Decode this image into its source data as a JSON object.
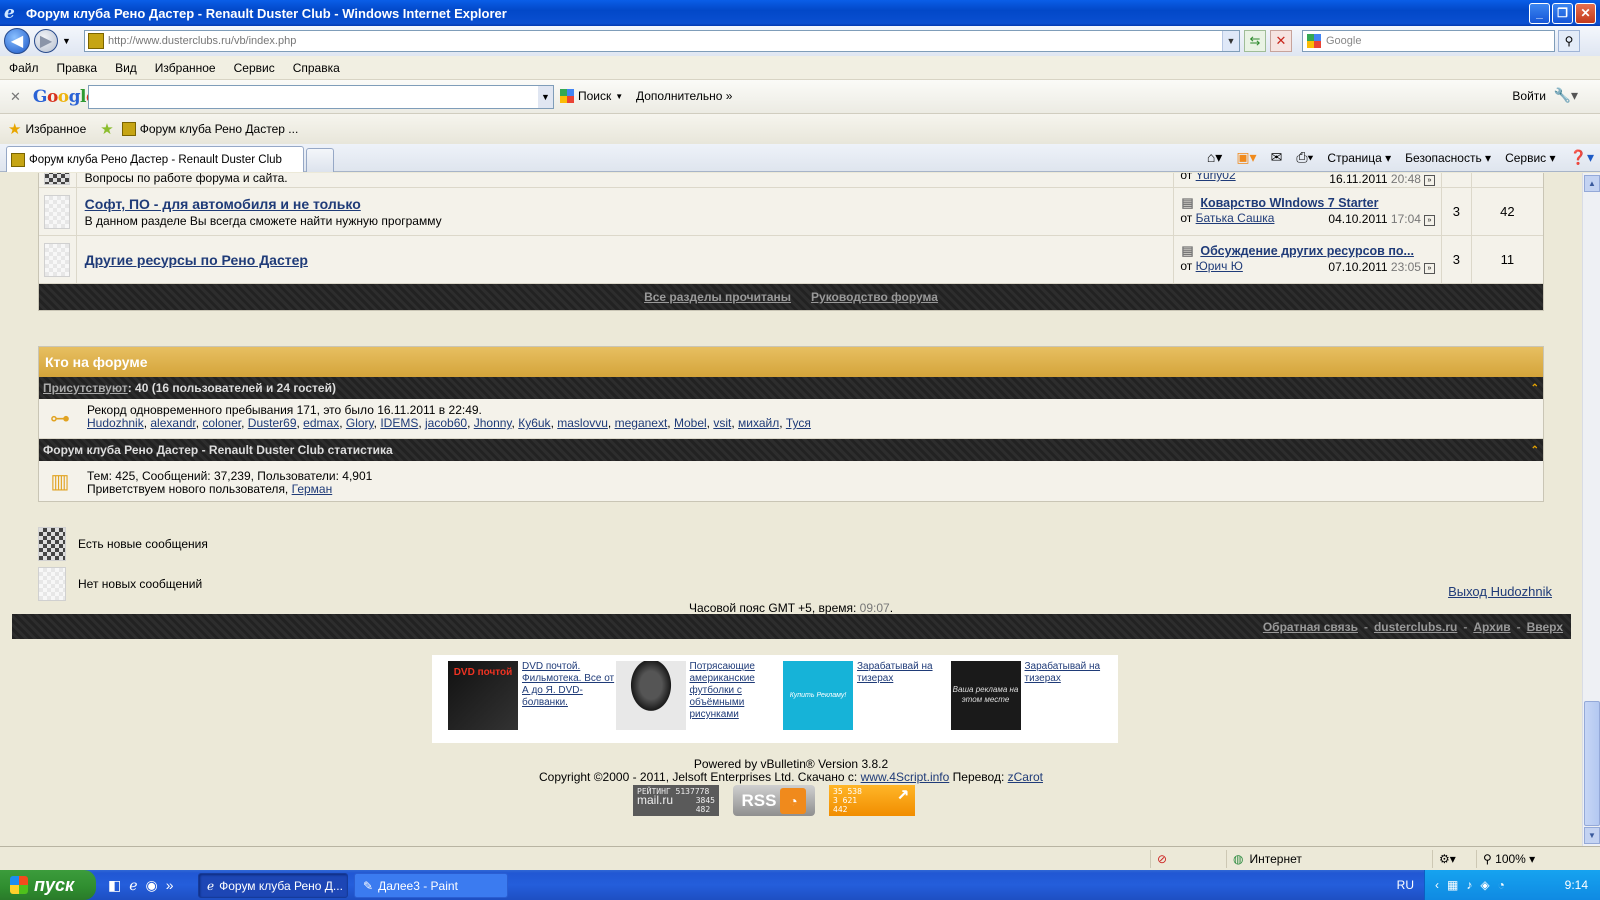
{
  "window": {
    "title": "Форум клуба Рено Дастер - Renault Duster Club - Windows Internet Explorer",
    "controls": [
      "_",
      "❐",
      "✕"
    ]
  },
  "address_bar": {
    "url": "http://www.dusterclubs.ru/vb/index.php",
    "search_placeholder": "Google"
  },
  "menu": [
    "Файл",
    "Правка",
    "Вид",
    "Избранное",
    "Сервис",
    "Справка"
  ],
  "google_toolbar": {
    "logo": "Google",
    "search_button": "Поиск",
    "more": "Дополнительно »",
    "login": "Войти"
  },
  "favorites_bar": {
    "favorites_label": "Избранное",
    "link": "Форум клуба Рено Дастер ..."
  },
  "tabs": {
    "active_tab": "Форум клуба Рено Дастер - Renault Duster Club"
  },
  "command_bar": {
    "page": "Страница",
    "security": "Безопасность",
    "service": "Сервис"
  },
  "forum": {
    "partial_row": {
      "description": "Вопросы по работе форума и сайта.",
      "last_by_prefix": "от",
      "last_by": "Yuriy02",
      "last_date": "16.11.2011",
      "last_time": "20:48"
    },
    "rows": [
      {
        "title": "Софт, ПО - для автомобиля и не только",
        "description": "В данном разделе Вы всегда сможете найти нужную программу",
        "last_title": "Коварство WIndows 7 Starter",
        "last_by_prefix": "от",
        "last_by": "Батька Сашка",
        "last_date": "04.10.2011",
        "last_time": "17:04",
        "threads": "3",
        "posts": "42"
      },
      {
        "title": "Другие ресурсы по Рено Дастер",
        "description": "",
        "last_title": "Обсуждение других ресурсов по...",
        "last_by_prefix": "от",
        "last_by": "Юрич Ю",
        "last_date": "07.10.2011",
        "last_time": "23:05",
        "threads": "3",
        "posts": "11"
      }
    ],
    "footer_links": [
      "Все разделы прочитаны",
      "Руководство форума"
    ]
  },
  "whos_online": {
    "header": "Кто на форуме",
    "present_label": "Присутствуют",
    "present_text": ": 40 (16 пользователей и 24 гостей)",
    "record_text": "Рекорд одновременного пребывания 171, это было 16.11.2011 в 22:49.",
    "users": [
      "Hudozhnik",
      "alexandr",
      "coloner",
      "Duster69",
      "edmax",
      "Glory",
      "IDEMS",
      "jacob60",
      "Jhonny",
      "Ку6uk",
      "maslovvu",
      "meganext",
      "Mobel",
      "vsit",
      "михайл",
      "Туся"
    ],
    "stats_header": "Форум клуба Рено Дастер - Renault Duster Club статистика",
    "stats_text": "Тем: 425, Сообщений: 37,239, Пользователи: 4,901",
    "welcome_prefix": "Приветствуем нового пользователя,",
    "new_user": "Герман"
  },
  "legend": {
    "new_posts": "Есть новые сообщения",
    "no_new_posts": "Нет новых сообщений"
  },
  "logout": "Выход Hudozhnik",
  "timezone": {
    "text": "Часовой пояс GMT +5, время:",
    "time": "09:07",
    "end": "."
  },
  "bottom_links": [
    "Обратная связь",
    "dusterclubs.ru",
    "Архив",
    "Вверх"
  ],
  "ads": [
    {
      "image_text": "DVD почтой",
      "text": "DVD почтой. Фильмотека. Все от А до Я. DVD- болванки."
    },
    {
      "image_text": "",
      "text": "Потрясающие американские футболки с объёмными рисунками"
    },
    {
      "image_text": "Купить Рекламу!",
      "text": "Зарабатывай на тизерах"
    },
    {
      "image_text": "Ваша реклама на этом месте",
      "text": "Зарабатывай на тизерах"
    }
  ],
  "credits": {
    "powered": "Powered by vBulletin® Version 3.8.2",
    "copyright": "Copyright ©2000 - 2011, Jelsoft Enterprises Ltd. Скачано с:",
    "download_link": "www.4Script.info",
    "translation_label": "Перевод:",
    "translator": "zCarot"
  },
  "badges": {
    "mail_label": "РЕЙТИНГ",
    "mail_brand": "mail.ru",
    "mail_values": [
      "5137778",
      "3845",
      "482"
    ],
    "rss": "RSS",
    "counter_values": [
      "35 538",
      "3 621",
      "442"
    ]
  },
  "status_bar": {
    "zone": "Интернет",
    "zoom": "100%"
  },
  "taskbar": {
    "start": "пуск",
    "buttons": [
      "Форум клуба Рено Д...",
      "Далее3 - Paint"
    ],
    "lang": "RU",
    "clock": "9:14"
  }
}
